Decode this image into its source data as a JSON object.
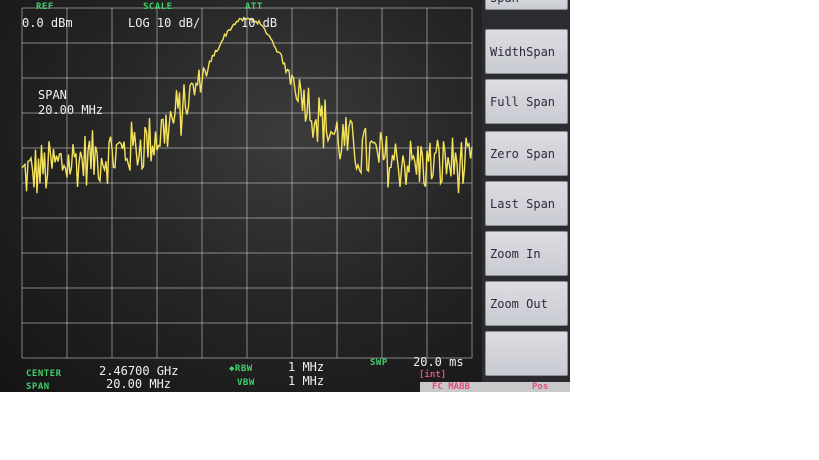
{
  "header": {
    "ref_label": "REF",
    "ref_value": "0.0 dBm",
    "scale_label": "SCALE",
    "scale_value": "LOG 10 dB/",
    "att_label": "ATT",
    "att_value": "10 dB"
  },
  "span_overlay": {
    "label": "SPAN",
    "value": "20.00 MHz"
  },
  "footer": {
    "center_label": "CENTER",
    "center_value": "2.46700 GHz",
    "span_label": "SPAN",
    "span_value": "20.00 MHz",
    "rbw_label": "◆RBW",
    "rbw_value": "1 MHz",
    "vbw_label": "VBW",
    "vbw_value": "1 MHz",
    "swp_label": "SWP",
    "swp_value": "20.0 ms",
    "swp_mode": "[int]",
    "status_left": "FC MABB",
    "status_right": "Pos"
  },
  "softkeys": [
    {
      "label": "Span"
    },
    {
      "label": "WidthSpan"
    },
    {
      "label": "Full Span"
    },
    {
      "label": "Zero Span"
    },
    {
      "label": "Last Span"
    },
    {
      "label": "Zoom In"
    },
    {
      "label": "Zoom Out"
    },
    {
      "label": ""
    }
  ],
  "colors": {
    "trace": "#f4e35a",
    "grid": "#d8d8d8",
    "label_green": "#3fcf6a",
    "label_white": "#f0f0f0"
  },
  "chart_data": {
    "type": "line",
    "title": "",
    "xlabel": "",
    "ylabel": "",
    "x_range_mhz": [
      2457.0,
      2477.0
    ],
    "ylim_dbm": [
      0,
      -100
    ],
    "grid": "on",
    "x_divisions": 10,
    "y_divisions": 10,
    "series": [
      {
        "x_mhz": [
          2457.0,
          2458.0,
          2459.0,
          2460.0,
          2461.0,
          2462.0,
          2463.0,
          2464.0,
          2465.0,
          2465.5,
          2466.0,
          2466.5,
          2466.8,
          2467.0,
          2467.2,
          2467.5,
          2468.0,
          2468.5,
          2469.0,
          2470.0,
          2471.0,
          2472.0,
          2473.0,
          2474.0,
          2475.0,
          2476.0,
          2477.0
        ],
        "y_dbm": [
          -48.0,
          -46.0,
          -44.0,
          -43.0,
          -42.0,
          -40.0,
          -37.0,
          -30.0,
          -20.0,
          -14.0,
          -8.0,
          -4.0,
          -3.3,
          -3.2,
          -3.3,
          -4.0,
          -8.0,
          -14.0,
          -20.0,
          -30.0,
          -37.0,
          -41.0,
          -43.0,
          -44.0,
          -45.0,
          -44.0,
          -46.0
        ],
        "noise_dB": 8
      }
    ]
  }
}
